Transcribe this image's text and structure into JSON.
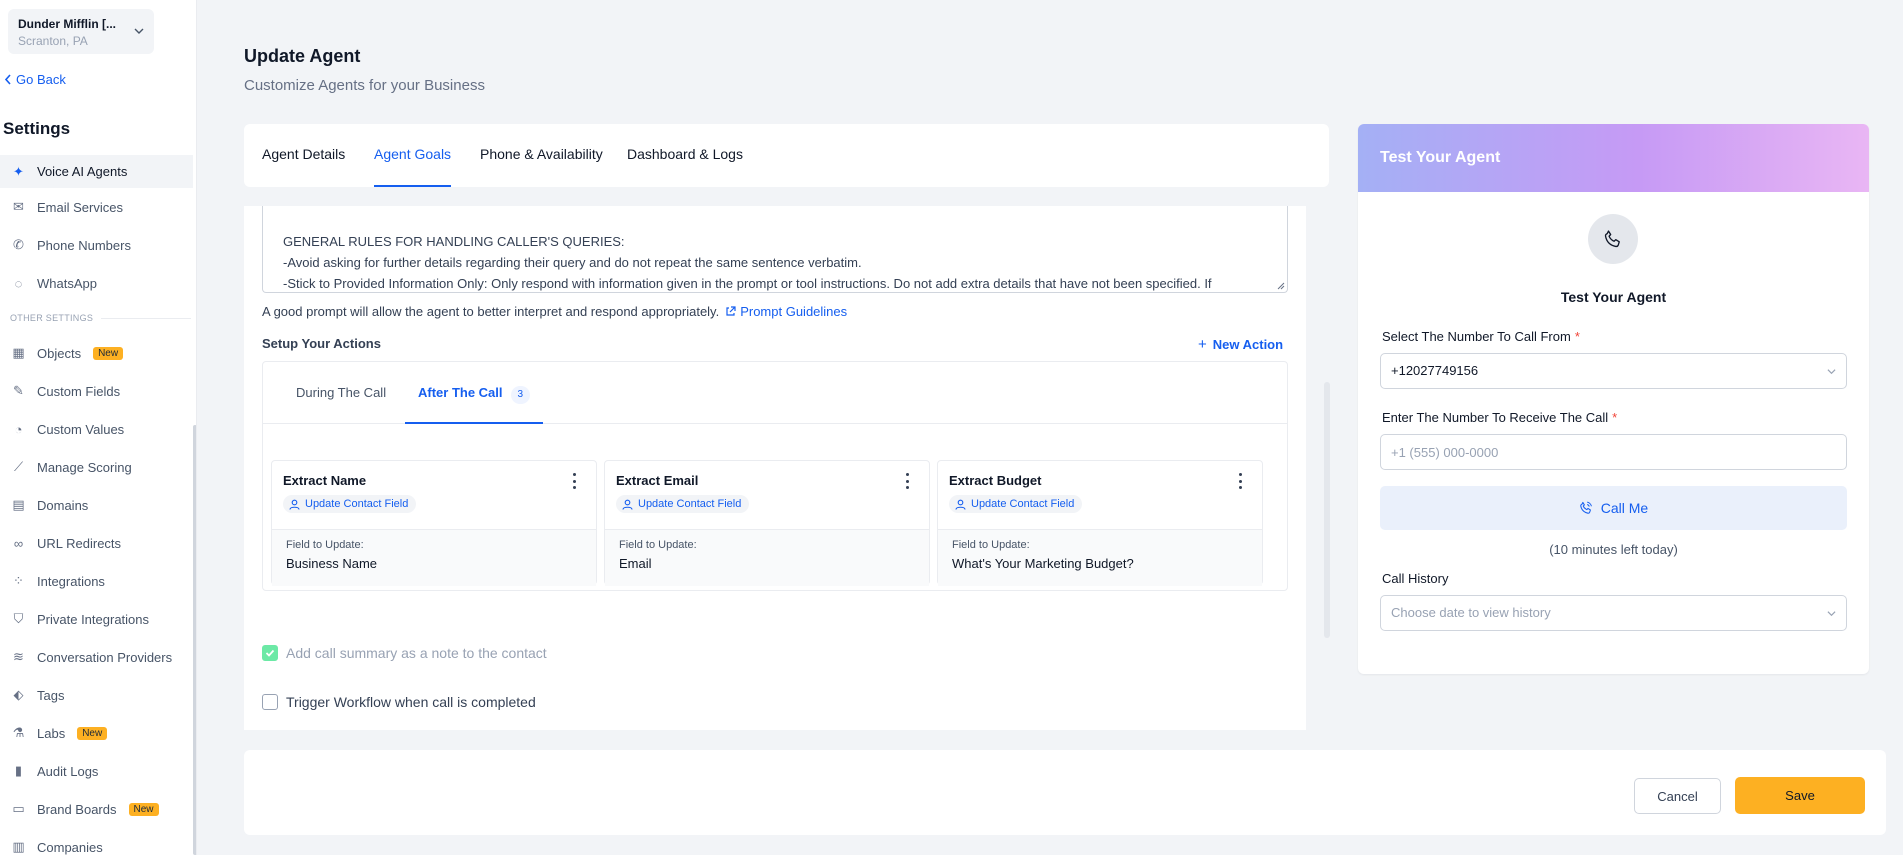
{
  "location": {
    "name": "Dunder Mifflin [...",
    "city": "Scranton, PA"
  },
  "go_back": "Go Back",
  "settings_title": "Settings",
  "nav": {
    "voice_ai": "Voice AI Agents",
    "email": "Email Services",
    "phone": "Phone Numbers",
    "whatsapp": "WhatsApp",
    "other_header": "OTHER SETTINGS",
    "objects": "Objects",
    "custom_fields": "Custom Fields",
    "custom_values": "Custom Values",
    "manage_scoring": "Manage Scoring",
    "domains": "Domains",
    "url_redirects": "URL Redirects",
    "integrations": "Integrations",
    "private_integrations": "Private Integrations",
    "conversation_providers": "Conversation Providers",
    "tags": "Tags",
    "labs": "Labs",
    "audit_logs": "Audit Logs",
    "brand_boards": "Brand Boards",
    "companies": "Companies",
    "new_badge": "New"
  },
  "header": {
    "title": "Update Agent",
    "subtitle": "Customize Agents for your Business"
  },
  "tabs": {
    "details": "Agent Details",
    "goals": "Agent Goals",
    "phone": "Phone & Availability",
    "dashboard": "Dashboard & Logs"
  },
  "prompt": {
    "line1": "GENERAL RULES FOR HANDLING CALLER'S QUERIES:",
    "line2": "-Avoid asking for further details regarding their query and do not repeat the same sentence verbatim.",
    "line3": "-Stick to Provided Information Only: Only respond with information given in the prompt or tool instructions. Do not add extra details that have not been specified. If"
  },
  "hint": {
    "text": "A good prompt will allow the agent to better interpret and respond appropriately.",
    "link": "Prompt Guidelines"
  },
  "actions": {
    "label": "Setup Your Actions",
    "new_action": "New Action",
    "tab_during": "During The Call",
    "tab_after": "After The Call",
    "after_count": "3",
    "cards": [
      {
        "title": "Extract Name",
        "pill": "Update Contact Field",
        "key": "Field to Update:",
        "value": "Business Name"
      },
      {
        "title": "Extract Email",
        "pill": "Update Contact Field",
        "key": "Field to Update:",
        "value": "Email"
      },
      {
        "title": "Extract Budget",
        "pill": "Update Contact Field",
        "key": "Field to Update:",
        "value": "What's Your Marketing Budget?"
      }
    ]
  },
  "options": {
    "summary": "Add call summary as a note to the contact",
    "trigger": "Trigger Workflow when call is completed"
  },
  "test": {
    "header": "Test Your Agent",
    "title": "Test Your Agent",
    "from_label": "Select The Number To Call From",
    "from_value": "+12027749156",
    "to_label": "Enter The Number To Receive The Call",
    "to_placeholder": "+1 (555) 000-0000",
    "call_button": "Call Me",
    "minutes": "(10 minutes left today)",
    "history_label": "Call History",
    "history_placeholder": "Choose date to view history",
    "required_mark": "*"
  },
  "footer": {
    "cancel": "Cancel",
    "save": "Save"
  },
  "colors": {
    "accent": "#155eef",
    "save": "#fdb022",
    "badge_new": "#fdb022",
    "check": "#6ce9a6"
  }
}
